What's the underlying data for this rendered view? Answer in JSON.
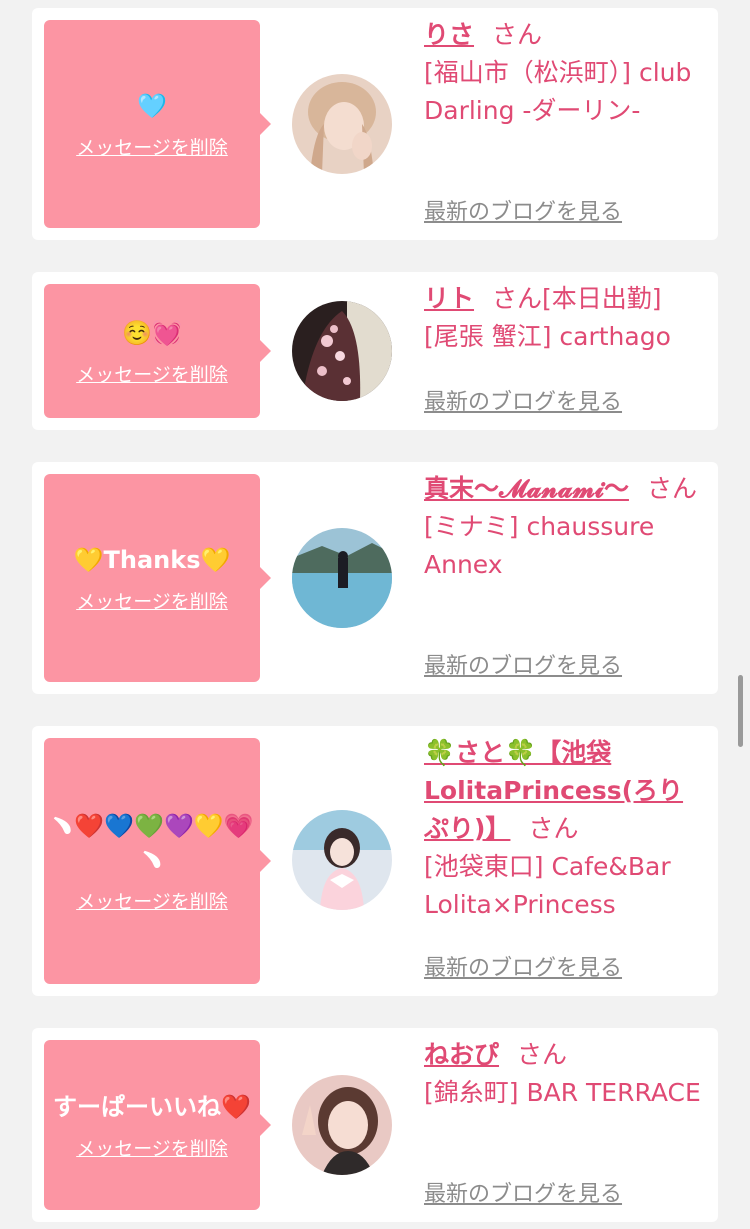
{
  "delete_label": "メッセージを削除",
  "blog_label": "最新のブログを見る",
  "colors": {
    "bubble": "#fc95a3",
    "accent": "#e04a74",
    "blog_link": "#8c8c8c"
  },
  "cards": [
    {
      "message": "🩵",
      "name": "りさ",
      "suffix": "さん",
      "shop": "[福山市（松浜町）] club Darling -ダーリン-"
    },
    {
      "message": "☺️💓",
      "name": "リト",
      "suffix": "さん[本日出勤]",
      "shop": "[尾張 蟹江] carthago"
    },
    {
      "message": "💛Thanks💛",
      "name": "真末〜𝓜𝓪𝓷𝓪𝓶𝓲〜",
      "suffix": "さん",
      "shop": "[ミナミ] chaussure Annex"
    },
    {
      "message": "﹅❤️💙💚💜💛💗﹅",
      "name": "🍀さと🍀【池袋LolitaPrincess(ろりぷり)】",
      "suffix": "さん",
      "shop": "[池袋東口] Cafe&Bar Lolita×Princess"
    },
    {
      "message": "すーぱーいいね❤️",
      "name": "ねおぴ",
      "suffix": "さん",
      "shop": "[錦糸町] BAR TERRACE"
    }
  ]
}
